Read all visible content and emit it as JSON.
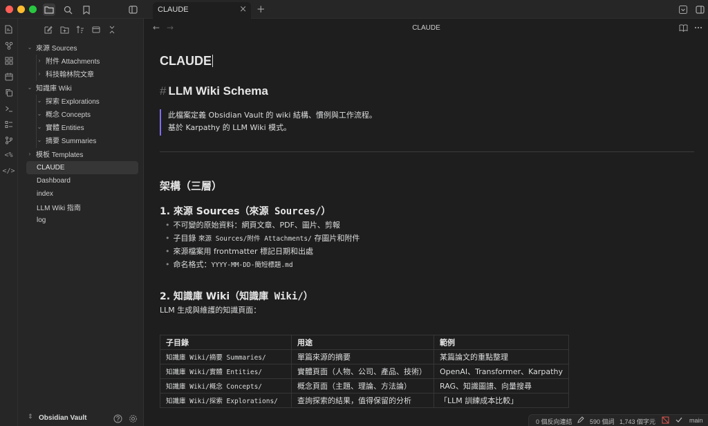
{
  "window": {
    "tab_title": "CLAUDE",
    "tab_close": "×",
    "new_tab": "+"
  },
  "sidebar": {
    "tree": [
      {
        "label": "來源 Sources",
        "depth": 0,
        "expanded": true
      },
      {
        "label": "附件 Attachments",
        "depth": 1,
        "expanded": false
      },
      {
        "label": "科技翰林院文章",
        "depth": 1,
        "expanded": false
      },
      {
        "label": "知識庫 Wiki",
        "depth": 0,
        "expanded": true
      },
      {
        "label": "探索 Explorations",
        "depth": 1,
        "expanded": true
      },
      {
        "label": "概念 Concepts",
        "depth": 1,
        "expanded": true
      },
      {
        "label": "實體 Entities",
        "depth": 1,
        "expanded": true
      },
      {
        "label": "摘要 Summaries",
        "depth": 1,
        "expanded": true
      },
      {
        "label": "模板 Templates",
        "depth": 0,
        "expanded": false
      },
      {
        "label": "CLAUDE",
        "depth": 0,
        "file": true,
        "active": true
      },
      {
        "label": "Dashboard",
        "depth": 0,
        "file": true
      },
      {
        "label": "index",
        "depth": 0,
        "file": true
      },
      {
        "label": "LLM Wiki 指南",
        "depth": 0,
        "file": true
      },
      {
        "label": "log",
        "depth": 0,
        "file": true
      }
    ],
    "vault_name": "Obsidian Vault"
  },
  "editor": {
    "view_title": "CLAUDE",
    "doc_title": "CLAUDE",
    "h1_hash": "#",
    "h1": "LLM Wiki Schema",
    "callout_lines": [
      "此檔案定義 Obsidian Vault 的 wiki 結構、慣例與工作流程。",
      "基於 Karpathy 的 LLM Wiki 模式。"
    ],
    "h2": "架構（三層）",
    "section1": {
      "title_prefix": "1. 來源 Sources（",
      "title_code": "來源 Sources/",
      "title_suffix": "）",
      "bullets": [
        {
          "text": "不可變的原始資料：網頁文章、PDF、圖片、剪報"
        },
        {
          "pre": "子目錄 ",
          "code": "來源 Sources/附件 Attachments/",
          "post": " 存圖片和附件"
        },
        {
          "text": "來源檔案用 frontmatter 標記日期和出處"
        },
        {
          "pre": "命名格式：",
          "code": "YYYY-MM-DD-簡短標題.md",
          "post": ""
        }
      ]
    },
    "section2": {
      "title_prefix": "2. 知識庫 Wiki（",
      "title_code": "知識庫 Wiki/",
      "title_suffix": "）",
      "para": "LLM 生成與維護的知識頁面："
    },
    "table": {
      "headers": [
        "子目錄",
        "用途",
        "範例"
      ],
      "rows": [
        [
          "知識庫 Wiki/摘要 Summaries/",
          "單篇來源的摘要",
          "某篇論文的重點整理"
        ],
        [
          "知識庫 Wiki/實體 Entities/",
          "實體頁面（人物、公司、產品、技術）",
          "OpenAI、Transformer、Karpathy"
        ],
        [
          "知識庫 Wiki/概念 Concepts/",
          "概念頁面（主題、理論、方法論）",
          "RAG、知識圖譜、向量搜尋"
        ],
        [
          "知識庫 Wiki/探索 Explorations/",
          "查詢探索的結果，值得保留的分析",
          "「LLM 訓練成本比較」"
        ]
      ]
    }
  },
  "status_bar": {
    "backlinks": "0 個反向連結",
    "words": "590 個詞",
    "chars": "1,743 個字元",
    "branch": "main"
  },
  "colors": {
    "accent": "#7f6df2",
    "background": "#1e1e1e",
    "sidebar": "#262626"
  }
}
